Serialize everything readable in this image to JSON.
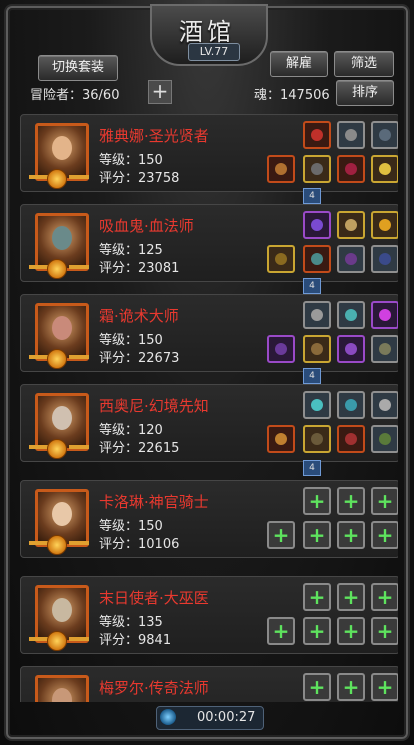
{
  "title": "酒馆",
  "level": "LV.77",
  "buttons": {
    "switch_outfit": "切换套装",
    "dismiss": "解雇",
    "filter": "筛选",
    "sort": "排序"
  },
  "adventurers_label": "冒险者：36/60",
  "soul_label": "魂：147506",
  "add_icon": "plus-icon",
  "level_prefix": "等级：",
  "score_prefix": "评分：",
  "heroes": [
    {
      "name": "雅典娜·圣光贤者",
      "level": "等级：150",
      "score": "评分：23758",
      "link": "4"
    },
    {
      "name": "吸血鬼·血法师",
      "level": "等级：125",
      "score": "评分：23081",
      "link": "4"
    },
    {
      "name": "霜·诡术大师",
      "level": "等级：150",
      "score": "评分：22673",
      "link": "4"
    },
    {
      "name": "西奥尼·幻境先知",
      "level": "等级：120",
      "score": "评分：22615",
      "link": "4"
    },
    {
      "name": "卡洛琳·神官骑士",
      "level": "等级：150",
      "score": "评分：10106"
    },
    {
      "name": "末日使者·大巫医",
      "level": "等级：135",
      "score": "评分：9841"
    },
    {
      "name": "梅罗尔·传奇法师",
      "level": "",
      "score": ""
    }
  ],
  "timer": "00:00:27",
  "colors": {
    "hero_name": "#e8392f",
    "accent_green": "#5ee35e",
    "gold": "#c9a632"
  }
}
